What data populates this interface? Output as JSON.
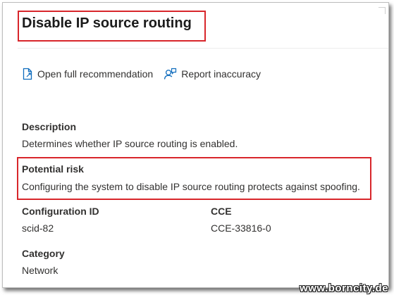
{
  "panel": {
    "title": "Disable IP source routing"
  },
  "actions": {
    "open_recommendation": "Open full recommendation",
    "report_inaccuracy": "Report inaccuracy"
  },
  "description": {
    "label": "Description",
    "value": "Determines whether IP source routing is enabled."
  },
  "potential_risk": {
    "label": "Potential risk",
    "value": "Configuring the system to disable IP source routing protects against spoofing."
  },
  "configuration_id": {
    "label": "Configuration ID",
    "value": "scid-82"
  },
  "cce": {
    "label": "CCE",
    "value": "CCE-33816-0"
  },
  "category": {
    "label": "Category",
    "value": "Network"
  },
  "watermark": {
    "text": "www.borncity.de"
  },
  "colors": {
    "highlight_border": "#d8262b",
    "icon_blue": "#0f6cbd",
    "text": "#323130"
  },
  "icons": {
    "open_recommendation": "document-icon",
    "report_inaccuracy": "person-feedback-icon"
  }
}
